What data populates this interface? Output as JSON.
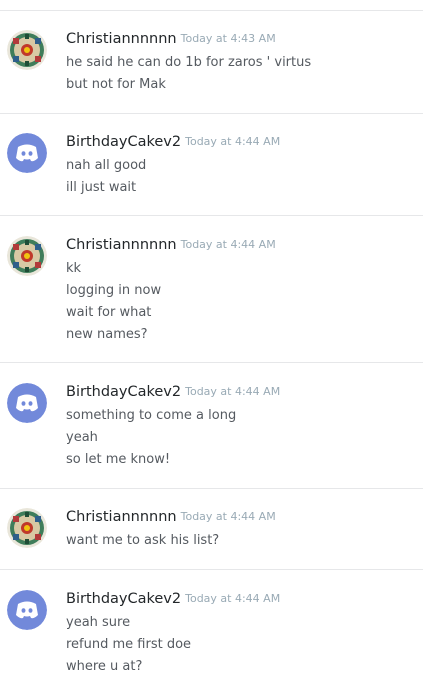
{
  "users": {
    "christian": "Christiannnnnn",
    "birthday": "BirthdayCakev2"
  },
  "colors": {
    "discord_blurple": "#7289da",
    "username": "#23272a",
    "timestamp": "#99aab5",
    "message_text": "#555a60",
    "divider": "#e6e7e9"
  },
  "messages": [
    {
      "author": "Christiannnnnn",
      "avatar": "custom-pattern-avatar",
      "time": "Today at 4:43 AM",
      "lines": [
        "he said he can do 1b for zaros ' virtus",
        "but not for Mak"
      ]
    },
    {
      "author": "BirthdayCakev2",
      "avatar": "discord-logo-avatar",
      "time": "Today at 4:44 AM",
      "lines": [
        "nah all good",
        "ill just wait"
      ]
    },
    {
      "author": "Christiannnnnn",
      "avatar": "custom-pattern-avatar",
      "time": "Today at 4:44 AM",
      "lines": [
        "kk",
        "logging in now",
        "wait for what",
        "new names?"
      ]
    },
    {
      "author": "BirthdayCakev2",
      "avatar": "discord-logo-avatar",
      "time": "Today at 4:44 AM",
      "lines": [
        "something to come a long",
        "yeah",
        "so let me know!"
      ]
    },
    {
      "author": "Christiannnnnn",
      "avatar": "custom-pattern-avatar",
      "time": "Today at 4:44 AM",
      "lines": [
        "want me to ask his list?"
      ]
    },
    {
      "author": "BirthdayCakev2",
      "avatar": "discord-logo-avatar",
      "time": "Today at 4:44 AM",
      "lines": [
        "yeah sure",
        "refund me first doe",
        "where u at?"
      ]
    }
  ]
}
